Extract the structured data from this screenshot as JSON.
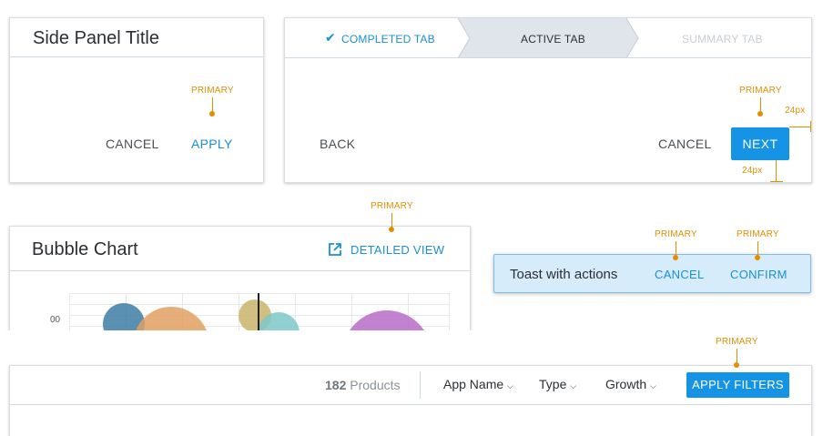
{
  "side_panel": {
    "title": "Side Panel Title",
    "cancel_label": "CANCEL",
    "apply_label": "APPLY",
    "primary_annotation": "PRIMARY"
  },
  "wizard": {
    "tabs": [
      {
        "label": "COMPLETED TAB",
        "state": "completed"
      },
      {
        "label": "ACTIVE TAB",
        "state": "active"
      },
      {
        "label": "SUMMARY TAB",
        "state": "disabled"
      }
    ],
    "back_label": "BACK",
    "cancel_label": "CANCEL",
    "next_label": "NEXT",
    "primary_annotation": "PRIMARY",
    "spacing_right": "24px",
    "spacing_bottom": "24px"
  },
  "bubble_chart": {
    "title": "Bubble Chart",
    "detailed_view_label": "DETAILED VIEW",
    "primary_annotation": "PRIMARY",
    "y_tick": "00"
  },
  "toast": {
    "message": "Toast with actions",
    "cancel_label": "CANCEL",
    "confirm_label": "CONFIRM",
    "cancel_annotation": "PRIMARY",
    "confirm_annotation": "PRIMARY"
  },
  "filter_bar": {
    "count": "182",
    "count_suffix": "Products",
    "filters": [
      "App Name",
      "Type",
      "Growth"
    ],
    "apply_label": "APPLY FILTERS",
    "primary_annotation": "PRIMARY"
  },
  "colors": {
    "accent": "#1a8fd8",
    "annotation": "#e38e00",
    "bubble_blue": "#3d7ea6",
    "bubble_orange": "#e0a060",
    "bubble_olive": "#c8b46a",
    "bubble_teal": "#7ec8c8",
    "bubble_purple": "#b86cc8",
    "toast_bg": "#d6ecfa"
  },
  "icons": {
    "completed": "check-icon",
    "external": "external-link-icon",
    "dropdown": "chevron-down-icon"
  }
}
